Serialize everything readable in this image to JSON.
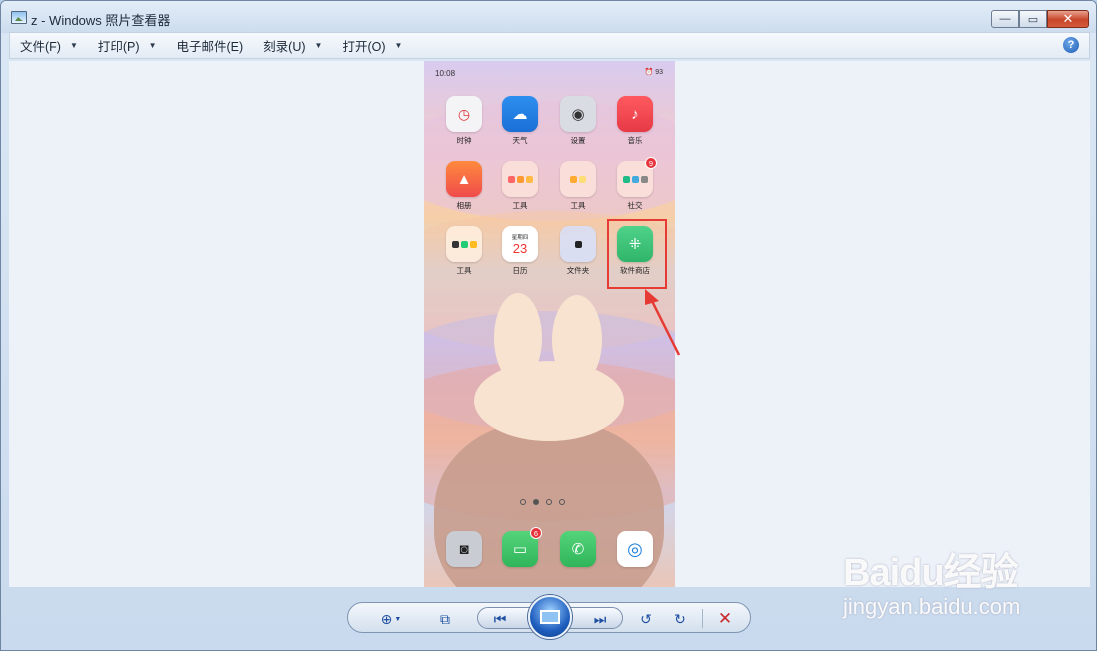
{
  "window": {
    "title": "z - Windows 照片查看器"
  },
  "caption_buttons": {
    "minimize": "—",
    "maximize": "▭",
    "close": "✕"
  },
  "menu": [
    {
      "label": "文件(F)"
    },
    {
      "label": "打印(P)"
    },
    {
      "label": "电子邮件(E)"
    },
    {
      "label": "刻录(U)"
    },
    {
      "label": "打开(O)"
    }
  ],
  "help": "?",
  "phone": {
    "status_time": "10:08",
    "status_right": "⏰ 93",
    "apps": [
      {
        "label": "时钟"
      },
      {
        "label": "天气"
      },
      {
        "label": "设置"
      },
      {
        "label": "音乐"
      },
      {
        "label": "相册"
      },
      {
        "label": "工具"
      },
      {
        "label": "工具"
      },
      {
        "label": "社交",
        "badge": "9"
      },
      {
        "label": "工具"
      },
      {
        "label": "日历",
        "day": "23",
        "weekday": "星期四"
      },
      {
        "label": "文件夹"
      },
      {
        "label": "软件商店"
      }
    ],
    "dock": [
      {
        "name": "camera"
      },
      {
        "name": "messages",
        "badge": "6"
      },
      {
        "name": "phone"
      },
      {
        "name": "browser"
      }
    ]
  },
  "colors": {
    "highlight": "#e63b35",
    "accent": "#1f5fbf"
  },
  "watermark": {
    "logo": "Baidu经验",
    "url": "jingyan.baidu.com"
  }
}
